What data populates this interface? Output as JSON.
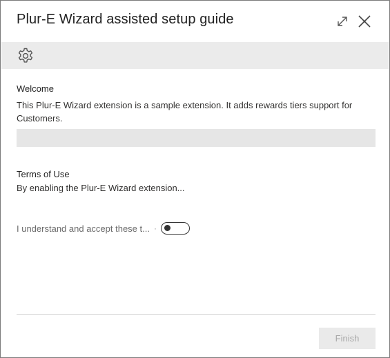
{
  "dialog": {
    "title": "Plur-E Wizard assisted setup guide",
    "expand_icon": "expand-icon",
    "close_icon": "close-icon"
  },
  "actionbar": {
    "settings_icon": "gear-icon"
  },
  "welcome": {
    "heading": "Welcome",
    "text": "This Plur-E Wizard extension is a sample extension. It adds rewards tiers support for Customers."
  },
  "terms": {
    "heading": "Terms of Use",
    "text": "By enabling the Plur-E Wizard extension..."
  },
  "accept": {
    "label": "I understand and accept these t...",
    "toggle_on": false
  },
  "footer": {
    "finish_label": "Finish",
    "finish_enabled": false
  }
}
